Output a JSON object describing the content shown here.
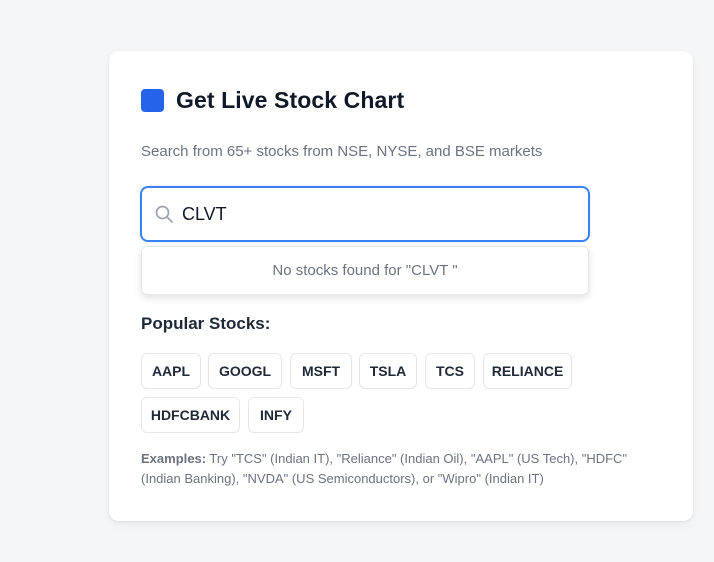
{
  "card": {
    "title": "Get Live Stock Chart",
    "subtitle": "Search from 65+ stocks from NSE, NYSE, and BSE markets"
  },
  "search": {
    "icon": "search-icon",
    "value": "CLVT",
    "no_results": "No stocks found for \"CLVT \""
  },
  "popular": {
    "heading": "Popular Stocks:",
    "stocks": [
      "AAPL",
      "GOOGL",
      "MSFT",
      "TSLA",
      "TCS",
      "RELIANCE",
      "HDFCBANK",
      "INFY"
    ]
  },
  "examples": {
    "label": "Examples:",
    "text": " Try \"TCS\" (Indian IT), \"Reliance\" (Indian Oil), \"AAPL\" (US Tech), \"HDFC\" (Indian Banking), \"NVDA\" (US Semiconductors), or \"Wipro\" (Indian IT)"
  },
  "colors": {
    "accent": "#2563eb",
    "focus_border": "#3b82f6",
    "text_primary": "#111827",
    "text_muted": "#6b7280"
  }
}
